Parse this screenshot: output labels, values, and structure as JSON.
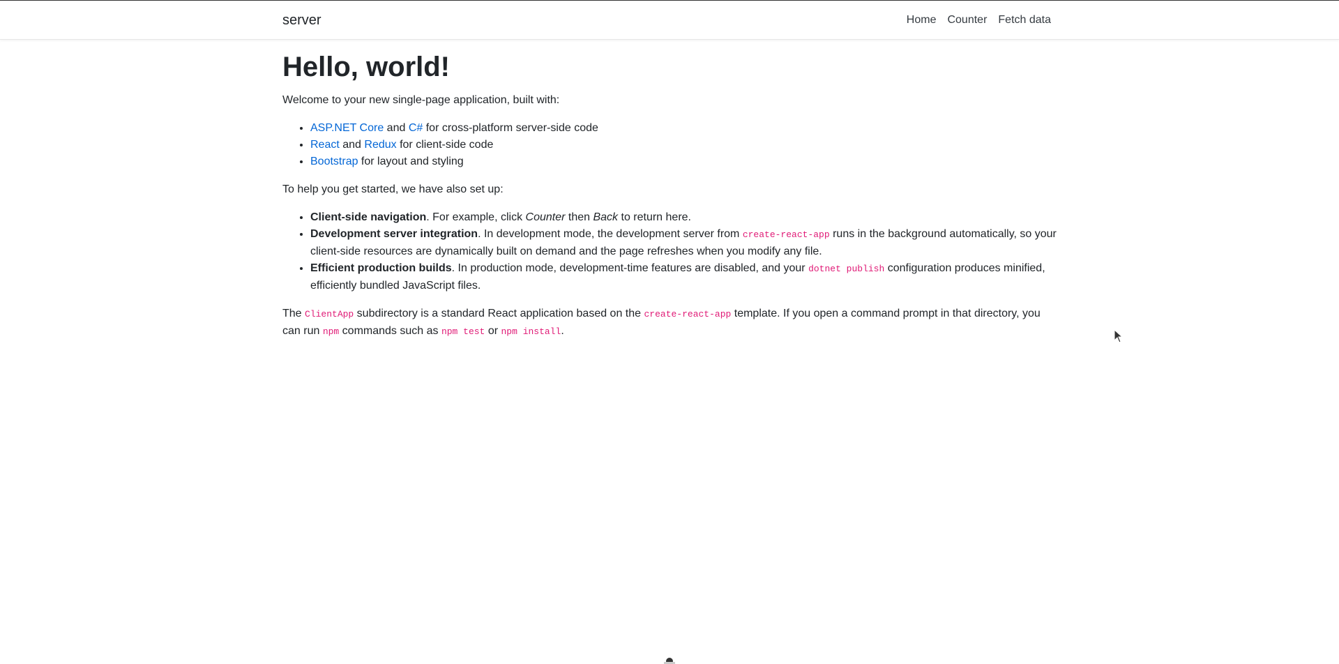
{
  "navbar": {
    "brand": "server",
    "links": [
      "Home",
      "Counter",
      "Fetch data"
    ]
  },
  "main": {
    "title": "Hello, world!",
    "intro": "Welcome to your new single-page application, built with:",
    "built_with": [
      {
        "link1": "ASP.NET Core",
        "mid": " and ",
        "link2": "C#",
        "rest": " for cross-platform server-side code"
      },
      {
        "link1": "React",
        "mid": " and ",
        "link2": "Redux",
        "rest": " for client-side code"
      },
      {
        "link1": "Bootstrap",
        "rest": " for layout and styling"
      }
    ],
    "setup_intro": "To help you get started, we have also set up:",
    "features": [
      {
        "bold": "Client-side navigation",
        "t1": ". For example, click ",
        "em1": "Counter",
        "t2": " then ",
        "em2": "Back",
        "t3": " to return here."
      },
      {
        "bold": "Development server integration",
        "t1": ". In development mode, the development server from ",
        "code": "create-react-app",
        "t2": " runs in the background automatically, so your client-side resources are dynamically built on demand and the page refreshes when you modify any file."
      },
      {
        "bold": "Efficient production builds",
        "t1": ". In production mode, development-time features are disabled, and your ",
        "code": "dotnet publish",
        "t2": " configuration produces minified, efficiently bundled JavaScript files."
      }
    ],
    "closing": {
      "t1": "The ",
      "c1": "ClientApp",
      "t2": " subdirectory is a standard React application based on the ",
      "c2": "create-react-app",
      "t3": " template. If you open a command prompt in that directory, you can run ",
      "c3": "npm",
      "t4": " commands such as ",
      "c4": "npm test",
      "t5": " or ",
      "c5": "npm install",
      "t6": "."
    }
  },
  "icons": {
    "cursor": "mouse-pointer-icon"
  }
}
